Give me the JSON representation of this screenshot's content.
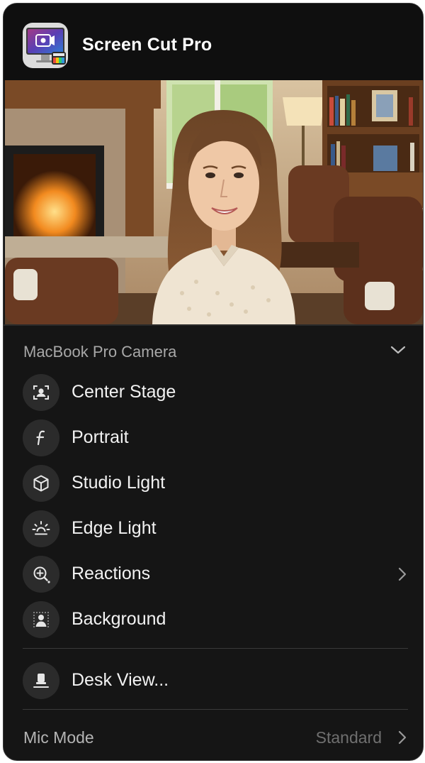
{
  "app": {
    "title": "Screen Cut Pro",
    "icon": "screen-cut-pro-app-icon"
  },
  "preview": {
    "description_icon": "camera-preview"
  },
  "camera": {
    "label": "MacBook Pro Camera",
    "chevron_icon": "chevron-down-icon"
  },
  "menu": {
    "items": [
      {
        "label": "Center Stage",
        "icon": "center-stage-icon"
      },
      {
        "label": "Portrait",
        "icon": "portrait-f-icon"
      },
      {
        "label": "Studio Light",
        "icon": "cube-icon"
      },
      {
        "label": "Edge Light",
        "icon": "sun-icon"
      },
      {
        "label": "Reactions",
        "icon": "reactions-icon",
        "has_submenu": true
      },
      {
        "label": "Background",
        "icon": "background-person-icon"
      }
    ],
    "desk_view": {
      "label": "Desk View...",
      "icon": "desk-view-icon"
    }
  },
  "mic": {
    "label": "Mic Mode",
    "value": "Standard"
  },
  "colors": {
    "panel_bg": "#151515",
    "header_bg": "#0f0f0f",
    "icon_circle": "#2b2b2b",
    "text_primary": "#f2f2f2",
    "text_secondary": "#a8a8a8",
    "text_muted": "#6f6f6f"
  }
}
